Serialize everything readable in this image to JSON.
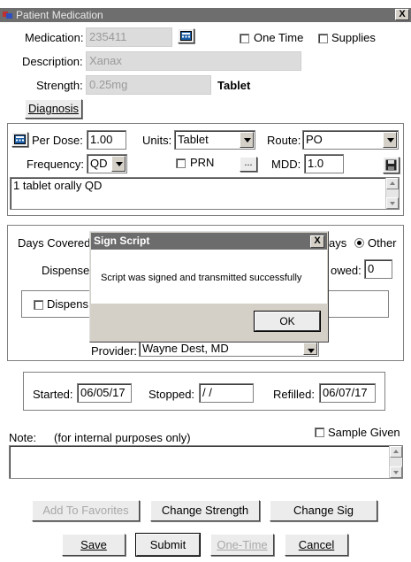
{
  "window": {
    "title": "Patient Medication",
    "close_label": "X"
  },
  "medication": {
    "label": "Medication:",
    "value": "235411",
    "one_time_label": "One Time",
    "supplies_label": "Supplies",
    "description_label": "Description:",
    "description_value": "Xanax",
    "strength_label": "Strength:",
    "strength_value": "0.25mg",
    "form": "Tablet",
    "diagnosis_button": "Diagnosis"
  },
  "dosing": {
    "per_dose_label": "Per Dose:",
    "per_dose_value": "1.00",
    "units_label": "Units:",
    "units_value": "Tablet",
    "route_label": "Route:",
    "route_value": "PO",
    "frequency_label": "Frequency:",
    "frequency_value": "QD",
    "prn_label": "PRN",
    "ellipsis_label": "...",
    "mdd_label": "MDD:",
    "mdd_value": "1.0",
    "sig_text": "1 tablet orally QD"
  },
  "supply": {
    "days_covered_label": "Days Covered",
    "days_suffix": "ays",
    "other_label": "Other",
    "dispense_label": "Dispense",
    "allowed_suffix": "owed:",
    "allowed_value": "0",
    "dispense_check_label": "Dispens",
    "provider_label": "Provider:",
    "provider_value": "Wayne Dest, MD"
  },
  "dates": {
    "started_label": "Started:",
    "started_value": "06/05/17",
    "stopped_label": "Stopped:",
    "stopped_value": " / /",
    "refilled_label": "Refilled:",
    "refilled_value": "06/07/17"
  },
  "notes": {
    "note_label": "Note:",
    "note_hint": "(for internal purposes only)",
    "sample_given_label": "Sample Given",
    "note_value": ""
  },
  "buttons": {
    "add_favorites": "Add To Favorites",
    "change_strength": "Change Strength",
    "change_sig": "Change Sig",
    "save": "Save",
    "submit": "Submit",
    "one_time": "One-Time",
    "cancel": "Cancel"
  },
  "dialog": {
    "title": "Sign Script",
    "close_label": "X",
    "message": "Script was signed and transmitted successfully",
    "ok_label": "OK"
  },
  "colors": {
    "title_bar": "#6e6e6e",
    "dialog_title": "#6c6c6c",
    "face": "#d4d0c8"
  }
}
